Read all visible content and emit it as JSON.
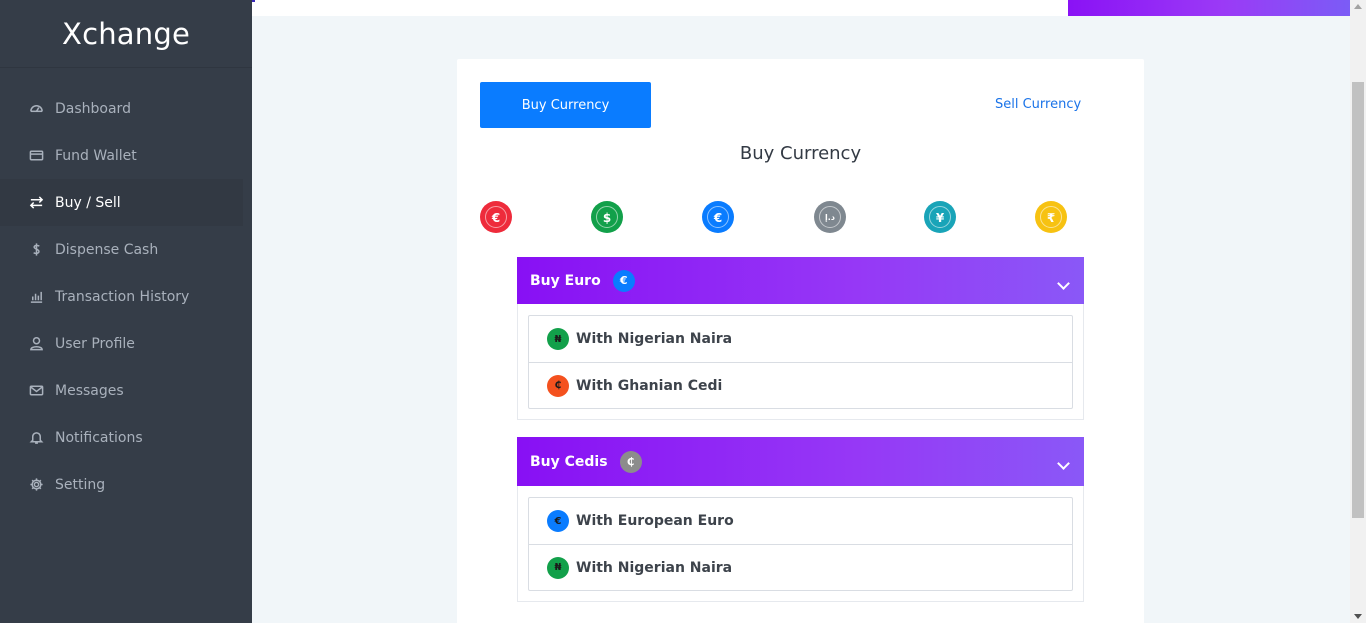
{
  "app": {
    "title": "Xchange"
  },
  "sidebar": {
    "items": [
      {
        "label": "Dashboard",
        "icon": "dashboard-icon",
        "active": false
      },
      {
        "label": "Fund Wallet",
        "icon": "credit-card-icon",
        "active": false
      },
      {
        "label": "Buy / Sell",
        "icon": "exchange-arrows-icon",
        "active": true
      },
      {
        "label": "Dispense Cash",
        "icon": "dollar-icon",
        "active": false
      },
      {
        "label": "Transaction History",
        "icon": "bar-chart-icon",
        "active": false
      },
      {
        "label": "User Profile",
        "icon": "user-icon",
        "active": false
      },
      {
        "label": "Messages",
        "icon": "envelope-icon",
        "active": false
      },
      {
        "label": "Notifications",
        "icon": "bell-icon",
        "active": false
      },
      {
        "label": "Setting",
        "icon": "gear-icon",
        "active": false
      }
    ]
  },
  "main": {
    "buy_button_label": "Buy Currency",
    "sell_link_label": "Sell Currency",
    "title": "Buy Currency",
    "currency_icons": [
      {
        "name": "euro-icon",
        "symbol": "€",
        "color": "#ee2b3b"
      },
      {
        "name": "dollar-icon",
        "symbol": "$",
        "color": "#12a04a"
      },
      {
        "name": "euro-icon",
        "symbol": "€",
        "color": "#0a7cff"
      },
      {
        "name": "dirham-icon",
        "symbol": "د.إ",
        "color": "#7f8890"
      },
      {
        "name": "yen-icon",
        "symbol": "¥",
        "color": "#19a4b8"
      },
      {
        "name": "rupee-icon",
        "symbol": "₹",
        "color": "#f7c212"
      }
    ],
    "sections": [
      {
        "title": "Buy Euro",
        "badge_symbol": "€",
        "badge_color": "#0a7cff",
        "options": [
          {
            "label": "With Nigerian Naira",
            "symbol": "₦",
            "color": "#12a04a"
          },
          {
            "label": "With Ghanian Cedi",
            "symbol": "₵",
            "color": "#f4511e"
          }
        ]
      },
      {
        "title": "Buy Cedis",
        "badge_symbol": "₵",
        "badge_color": "#8c8c8c",
        "options": [
          {
            "label": "With European Euro",
            "symbol": "€",
            "color": "#0a7cff"
          },
          {
            "label": "With Nigerian Naira",
            "symbol": "₦",
            "color": "#12a04a"
          }
        ]
      }
    ]
  },
  "colors": {
    "sidebar_bg": "#353d48",
    "primary": "#0a7cff",
    "accent_purple": "#8810f4",
    "page_bg": "#f1f6f9"
  }
}
